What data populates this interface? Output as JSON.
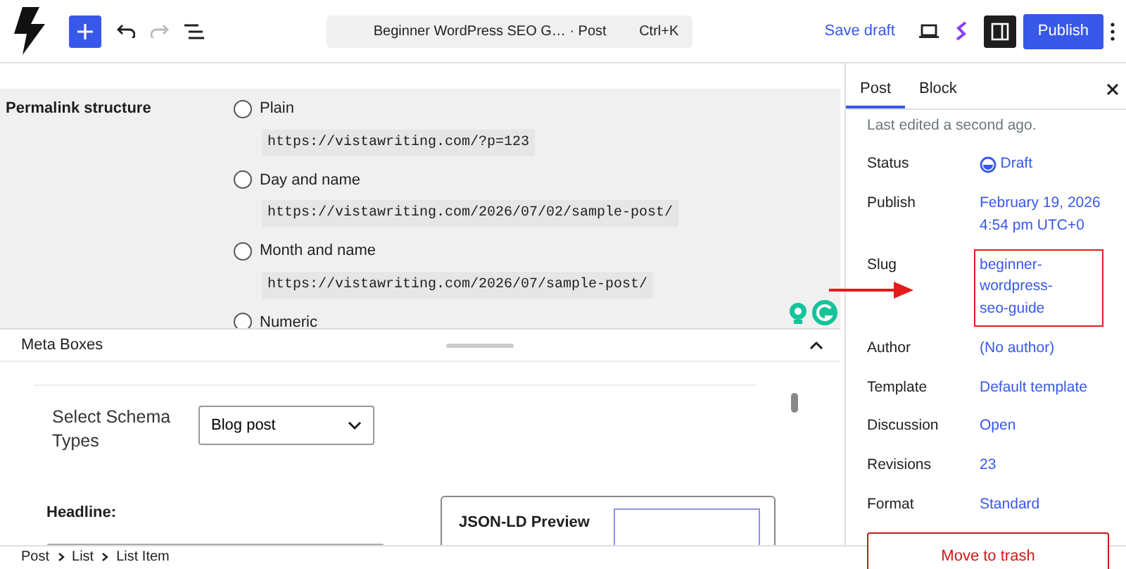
{
  "toolbar": {
    "command_bar": {
      "title": "Beginner WordPress SEO G…",
      "type": "· Post",
      "shortcut": "Ctrl+K"
    },
    "save_draft": "Save draft",
    "publish": "Publish"
  },
  "settings": {
    "label": "Permalink structure",
    "options": [
      {
        "label": "Plain",
        "example": "https://vistawriting.com/?p=123",
        "selected": false
      },
      {
        "label": "Day and name",
        "example": "https://vistawriting.com/2026/07/02/sample-post/",
        "selected": false
      },
      {
        "label": "Month and name",
        "example": "https://vistawriting.com/2026/07/sample-post/",
        "selected": false
      },
      {
        "label": "Numeric",
        "selected": false
      }
    ]
  },
  "meta_boxes": {
    "title": "Meta Boxes",
    "schema_label": "Select Schema Types",
    "schema_value": "Blog post",
    "headline_label": "Headline:",
    "preview_title": "JSON-LD Preview"
  },
  "sidebar": {
    "tabs": [
      {
        "label": "Post",
        "selected": true
      },
      {
        "label": "Block",
        "selected": false
      }
    ],
    "last_edited": "Last edited a second ago.",
    "fields": [
      {
        "label": "Status",
        "value": "Draft",
        "kind": "status",
        "annotated": false
      },
      {
        "label": "Publish",
        "value": "February 19, 2026 4:54 pm UTC+0",
        "kind": "link",
        "annotated": false
      },
      {
        "label": "Slug",
        "value": "beginner-wordpress-seo-guide",
        "kind": "link",
        "annotated": true
      },
      {
        "label": "Author",
        "value": "(No author)",
        "kind": "link",
        "annotated": false
      },
      {
        "label": "Template",
        "value": "Default template",
        "kind": "link",
        "annotated": false
      },
      {
        "label": "Discussion",
        "value": "Open",
        "kind": "link",
        "annotated": false
      },
      {
        "label": "Revisions",
        "value": "23",
        "kind": "link",
        "annotated": false
      },
      {
        "label": "Format",
        "value": "Standard",
        "kind": "link",
        "annotated": false
      }
    ],
    "trash": "Move to trash"
  },
  "breadcrumb": [
    "Post",
    "List",
    "List Item"
  ]
}
